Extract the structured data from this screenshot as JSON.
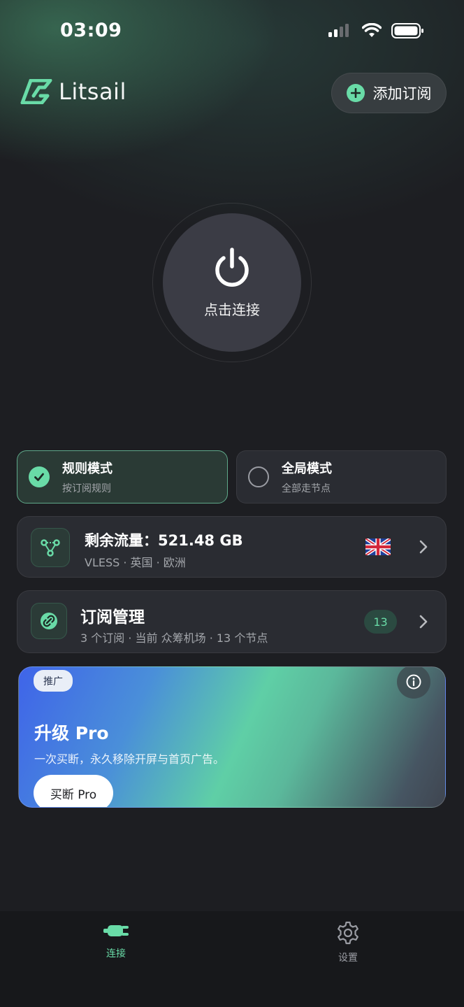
{
  "status_bar": {
    "time": "03:09"
  },
  "header": {
    "app_name": "Litsail",
    "add_button_label": "添加订阅"
  },
  "power": {
    "label": "点击连接"
  },
  "modes": [
    {
      "title": "规则模式",
      "subtitle": "按订阅规则",
      "selected": true
    },
    {
      "title": "全局模式",
      "subtitle": "全部走节点",
      "selected": false
    }
  ],
  "traffic": {
    "title": "剩余流量：521.48 GB",
    "details": "VLESS · 英国 · 欧洲",
    "flag_icon": "uk-flag-icon"
  },
  "subscription": {
    "title": "订阅管理",
    "details": "3 个订阅 · 当前 众筹机场 · 13 个节点",
    "count": "13"
  },
  "promo": {
    "tag": "推广",
    "title": "升级 Pro",
    "description": "一次买断，永久移除开屏与首页广告。",
    "button_label": "买断 Pro"
  },
  "tabs": [
    {
      "label": "连接",
      "active": true
    },
    {
      "label": "设置",
      "active": false
    }
  ],
  "colors": {
    "accent": "#69dba7",
    "background": "#1d1e22",
    "card": "#2a2c32"
  }
}
